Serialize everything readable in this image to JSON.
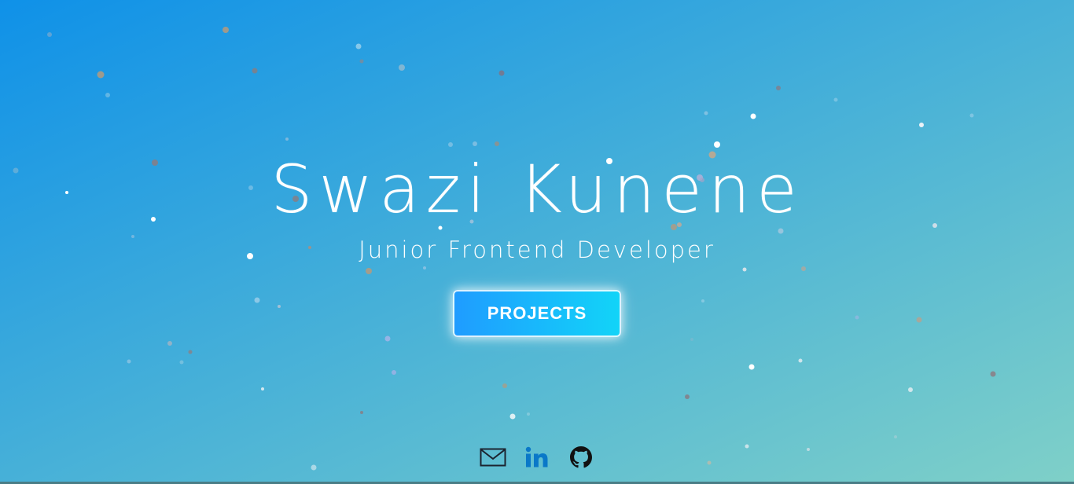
{
  "colors": {
    "gradient_start": "#0f91e8",
    "gradient_end": "#7fd0c8",
    "button_start": "#1f9cff",
    "button_end": "#12d4f8",
    "text": "#ffffff",
    "mail_icon": "#1c2430",
    "linkedin_icon": "#0a78c8",
    "github_icon": "#111111",
    "bottom_strip": "#4a7d86"
  },
  "hero": {
    "name": "Swazi Kunene",
    "role": "Junior Frontend Developer",
    "cta_label": "PROJECTS"
  },
  "social": [
    {
      "icon": "mail-icon"
    },
    {
      "icon": "linkedin-icon"
    },
    {
      "icon": "github-icon"
    }
  ]
}
